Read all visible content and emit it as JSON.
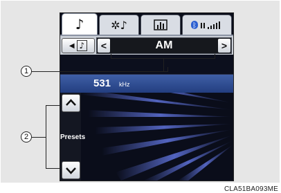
{
  "tabs": [
    {
      "name": "audio",
      "icon": "music-note-icon"
    },
    {
      "name": "sound",
      "icon": "sound-settings-icon"
    },
    {
      "name": "equalizer",
      "icon": "equalizer-icon"
    },
    {
      "name": "status",
      "icon": "bluetooth-signal-icon"
    }
  ],
  "topbar": {
    "source_icon": "music-note-icon",
    "prev_label": "<",
    "band": "AM",
    "next_label": ">"
  },
  "station": {
    "frequency": "531",
    "unit": "kHz"
  },
  "presets": {
    "label": "Presets",
    "up_icon": "chevron-up-icon",
    "down_icon": "chevron-down-icon"
  },
  "callouts": {
    "one": "1",
    "two": "2"
  },
  "caption": "CLA51BA093ME",
  "colors": {
    "accent_blue": "#2f4f99",
    "screen_bg": "#0a0d1a",
    "frame_gray": "#e6e6e6"
  }
}
